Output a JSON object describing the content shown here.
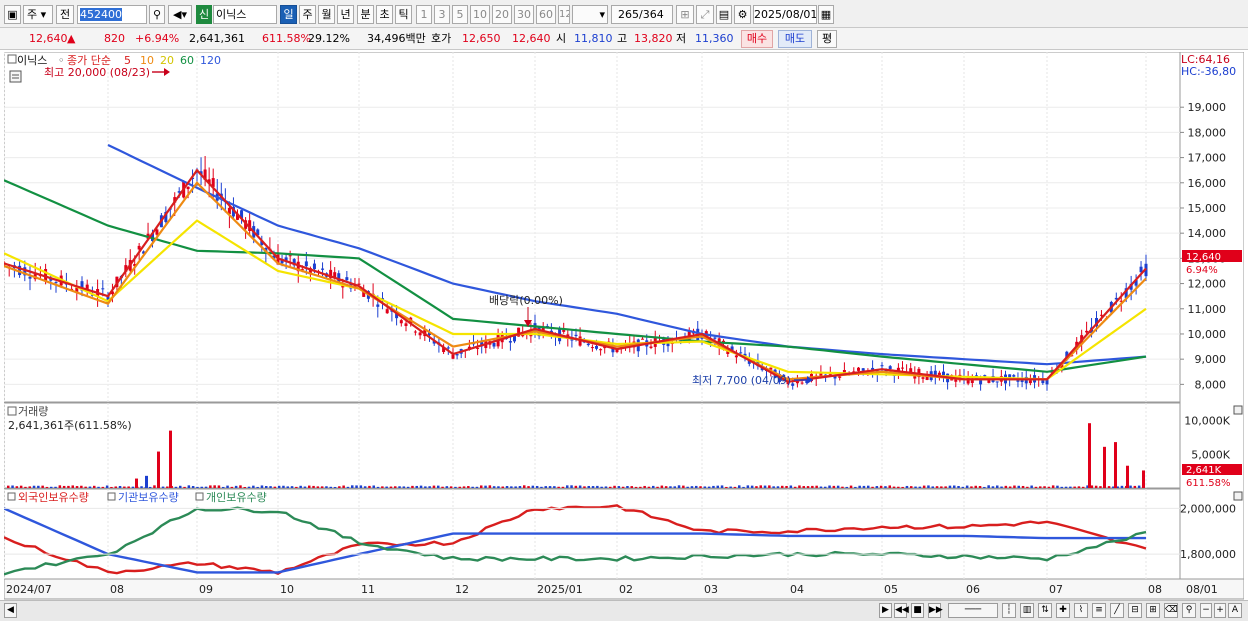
{
  "toolbar": {
    "market_label": "주",
    "prev_label": "전",
    "code": "452400",
    "stock_badge": "신",
    "stock_name": "이닉스",
    "periods": [
      "일",
      "주",
      "월",
      "년",
      "분",
      "초",
      "틱"
    ],
    "active_period": "일",
    "intervals": [
      "1",
      "3",
      "5",
      "10",
      "20",
      "30",
      "60",
      "120"
    ],
    "count": "265",
    "total": "/364",
    "date": "2025/08/01"
  },
  "info": {
    "price": "12,640",
    "arrow": "▲",
    "change": "820",
    "change_pct": "+6.94%",
    "volume": "2,641,361",
    "vol_ratio": "611.58%",
    "turnover": "29.12%",
    "amount": "34,496백만",
    "ask_label": "호가",
    "ask": "12,650",
    "bid": "12,640",
    "open_label": "시",
    "open": "11,810",
    "high_label": "고",
    "high": "13,820",
    "low_label": "저",
    "low": "11,360",
    "buy_button": "매수",
    "sell_button": "매도",
    "eval_button": "평"
  },
  "price_panel": {
    "name": "이닉스",
    "ma_title": "종가 단순",
    "ma_periods": [
      "5",
      "10",
      "20",
      "60",
      "120"
    ],
    "ma_colors": [
      "#d81e1e",
      "#ee8a12",
      "#f5e400",
      "#129042",
      "#2f57dc"
    ],
    "high_note": "최고 20,000 (08/23)",
    "low_note": "최저 7,700 (04/09)",
    "dividend_note": "배당락(0.00%)",
    "lc": "LC:64,16",
    "hc": "HC:-36,80",
    "y_ticks": [
      "19,000",
      "18,000",
      "17,000",
      "16,000",
      "15,000",
      "14,000",
      "13,000",
      "12,000",
      "11,000",
      "10,000",
      "9,000",
      "8,000"
    ],
    "last_price_tag": "12,640",
    "last_pct_tag": "6.94%"
  },
  "volume_panel": {
    "title": "거래량",
    "value": "2,641,361주(611.58%)",
    "y_ticks": [
      "10,000K",
      "5,000K"
    ],
    "last_tag": "2,641K",
    "last_pct": "611.58%"
  },
  "holding_panel": {
    "series": [
      "외국인보유수량",
      "기관보유수량",
      "개인보유수량"
    ],
    "colors": [
      "#d81e1e",
      "#2f57dc",
      "#2c8a57"
    ],
    "y_ticks": [
      "2,000,000",
      "1,800,000"
    ]
  },
  "x_axis": {
    "labels": [
      "2024/07",
      "08",
      "09",
      "10",
      "11",
      "12",
      "2025/01",
      "02",
      "03",
      "04",
      "05",
      "06",
      "07",
      "08",
      "08/01"
    ]
  },
  "chart_data": {
    "type": "line",
    "title": "",
    "xlabel": "",
    "ylabel": "",
    "ylim": [
      7300,
      20000
    ],
    "x": [
      "2024/07",
      "08",
      "09",
      "10",
      "11",
      "12",
      "2025/01",
      "02",
      "03",
      "04",
      "05",
      "06",
      "07",
      "08"
    ],
    "series": [
      {
        "name": "5",
        "values": [
          12800,
          11500,
          16500,
          13000,
          11900,
          9200,
          10200,
          9400,
          10000,
          8100,
          8600,
          8200,
          8200,
          12600
        ]
      },
      {
        "name": "10",
        "values": [
          12700,
          11200,
          16000,
          12800,
          11800,
          9500,
          10100,
          9500,
          9900,
          8200,
          8500,
          8200,
          8200,
          12200
        ]
      },
      {
        "name": "20",
        "values": [
          13200,
          11300,
          14500,
          12500,
          11800,
          10000,
          10000,
          9600,
          9700,
          8500,
          8400,
          8300,
          8200,
          11000
        ]
      },
      {
        "name": "60",
        "values": [
          16100,
          14300,
          13300,
          13200,
          13000,
          10600,
          10300,
          10000,
          9700,
          9500,
          9100,
          8800,
          8500,
          9100
        ]
      },
      {
        "name": "120",
        "values": [
          null,
          17500,
          15800,
          14300,
          13400,
          12000,
          11300,
          10800,
          10000,
          9500,
          9200,
          9000,
          8800,
          9100
        ]
      }
    ],
    "volume_ylim": [
      0,
      12000
    ],
    "volume_ticks": [
      10000,
      5000
    ],
    "holdings_ylim": [
      1700000,
      2050000
    ],
    "holdings_ticks": [
      2000000,
      1800000
    ],
    "holdings": [
      {
        "name": "외국인보유수량",
        "values": [
          1870000,
          1720000,
          1760000,
          1720000,
          1840000,
          1850000,
          2000000,
          2010000,
          1900000,
          1900000,
          1920000,
          1920000,
          1940000,
          1820000
        ]
      },
      {
        "name": "기관보유수량",
        "values": [
          2000000,
          1800000,
          1720000,
          1720000,
          1800000,
          1890000,
          1890000,
          1890000,
          1890000,
          1880000,
          1880000,
          1880000,
          1870000,
          1870000
        ]
      },
      {
        "name": "개인보유수량",
        "values": [
          1720000,
          1800000,
          2000000,
          1990000,
          1850000,
          1780000,
          1780000,
          1780000,
          1790000,
          1800000,
          1800000,
          1790000,
          1780000,
          1890000
        ]
      }
    ]
  }
}
